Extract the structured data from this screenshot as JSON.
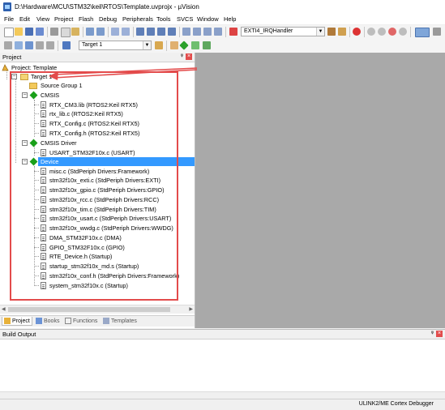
{
  "window": {
    "title": "D:\\Hardware\\MCU\\STM32\\keil\\RTOS\\Template.uvprojx - µVision"
  },
  "menu": [
    "File",
    "Edit",
    "View",
    "Project",
    "Flash",
    "Debug",
    "Peripherals",
    "Tools",
    "SVCS",
    "Window",
    "Help"
  ],
  "toolbar": {
    "find_combo": "EXTI4_IRQHandler",
    "target_combo": "Target 1"
  },
  "project_panel": {
    "title": "Project",
    "pin": "ᵠ",
    "close": "×",
    "root": "Project: Template",
    "target": "Target 1",
    "groups": [
      {
        "name": "Source Group 1",
        "items": []
      },
      {
        "name": "CMSIS",
        "items": [
          "RTX_CM3.lib (RTOS2:Keil RTX5)",
          "rtx_lib.c (RTOS2:Keil RTX5)",
          "RTX_Config.c (RTOS2:Keil RTX5)",
          "RTX_Config.h (RTOS2:Keil RTX5)"
        ]
      },
      {
        "name": "CMSIS Driver",
        "items": [
          "USART_STM32F10x.c (USART)"
        ]
      },
      {
        "name": "Device",
        "items": [
          "misc.c (StdPeriph Drivers:Framework)",
          "stm32f10x_exti.c (StdPeriph Drivers:EXTI)",
          "stm32f10x_gpio.c (StdPeriph Drivers:GPIO)",
          "stm32f10x_rcc.c (StdPeriph Drivers:RCC)",
          "stm32f10x_tim.c (StdPeriph Drivers:TIM)",
          "stm32f10x_usart.c (StdPeriph Drivers:USART)",
          "stm32f10x_wwdg.c (StdPeriph Drivers:WWDG)",
          "DMA_STM32F10x.c (DMA)",
          "GPIO_STM32F10x.c (GPIO)",
          "RTE_Device.h (Startup)",
          "startup_stm32f10x_md.s (Startup)",
          "stm32f10x_conf.h (StdPeriph Drivers:Framework)",
          "system_stm32f10x.c (Startup)"
        ]
      }
    ],
    "tabs": [
      "Project",
      "Books",
      "Functions",
      "Templates"
    ]
  },
  "build_output": {
    "title": "Build Output",
    "pin": "ᵠ",
    "close": "×"
  },
  "status": {
    "debugger": "ULINK2/ME Cortex Debugger"
  },
  "colors": {
    "highlight": "#e34b4b",
    "selection": "#3399ff",
    "editor_bg": "#a9a9a9"
  }
}
